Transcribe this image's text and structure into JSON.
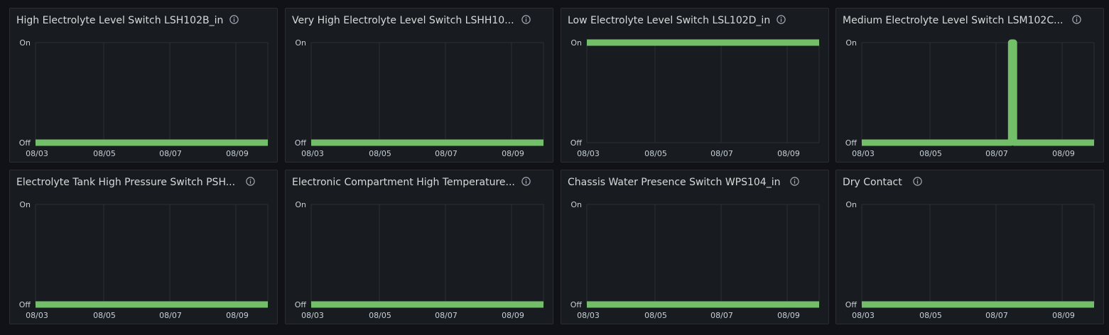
{
  "colors": {
    "series": "#73bf69",
    "panel_bg": "#181b1f",
    "page_bg": "#111217"
  },
  "panels": [
    {
      "title": "High Electrolyte Level Switch LSH102B_in",
      "chart_data": {
        "type": "line",
        "y_ticks": [
          "On",
          "Off"
        ],
        "x_ticks": [
          "08/03",
          "08/05",
          "08/07",
          "08/09"
        ],
        "points": [
          [
            0,
            0
          ],
          [
            1,
            0
          ]
        ]
      }
    },
    {
      "title": "Very High Electrolyte Level Switch LSHH10...",
      "chart_data": {
        "type": "line",
        "y_ticks": [
          "On",
          "Off"
        ],
        "x_ticks": [
          "08/03",
          "08/05",
          "08/07",
          "08/09"
        ],
        "points": [
          [
            0,
            0
          ],
          [
            1,
            0
          ]
        ]
      }
    },
    {
      "title": "Low Electrolyte Level Switch LSL102D_in",
      "chart_data": {
        "type": "line",
        "y_ticks": [
          "On",
          "Off"
        ],
        "x_ticks": [
          "08/03",
          "08/05",
          "08/07",
          "08/09"
        ],
        "points": [
          [
            0,
            1
          ],
          [
            1,
            1
          ]
        ]
      }
    },
    {
      "title": "Medium Electrolyte Level Switch LSM102C...",
      "chart_data": {
        "type": "line",
        "y_ticks": [
          "On",
          "Off"
        ],
        "x_ticks": [
          "08/03",
          "08/05",
          "08/07",
          "08/09"
        ],
        "points": [
          [
            0,
            0
          ],
          [
            0.643,
            0
          ],
          [
            0.643,
            1
          ],
          [
            0.655,
            1
          ],
          [
            0.655,
            0
          ],
          [
            1,
            0
          ]
        ]
      }
    },
    {
      "title": "Electrolyte Tank High Pressure Switch PSH...",
      "chart_data": {
        "type": "line",
        "y_ticks": [
          "On",
          "Off"
        ],
        "x_ticks": [
          "08/03",
          "08/05",
          "08/07",
          "08/09"
        ],
        "points": [
          [
            0,
            0
          ],
          [
            1,
            0
          ]
        ]
      }
    },
    {
      "title": "Electronic Compartment High Temperature...",
      "chart_data": {
        "type": "line",
        "y_ticks": [
          "On",
          "Off"
        ],
        "x_ticks": [
          "08/03",
          "08/05",
          "08/07",
          "08/09"
        ],
        "points": [
          [
            0,
            0
          ],
          [
            1,
            0
          ]
        ]
      }
    },
    {
      "title": "Chassis Water Presence Switch WPS104_in",
      "chart_data": {
        "type": "line",
        "y_ticks": [
          "On",
          "Off"
        ],
        "x_ticks": [
          "08/03",
          "08/05",
          "08/07",
          "08/09"
        ],
        "points": [
          [
            0,
            0
          ],
          [
            1,
            0
          ]
        ]
      }
    },
    {
      "title": "Dry Contact",
      "chart_data": {
        "type": "line",
        "y_ticks": [
          "On",
          "Off"
        ],
        "x_ticks": [
          "08/03",
          "08/05",
          "08/07",
          "08/09"
        ],
        "points": [
          [
            0,
            0
          ],
          [
            1,
            0
          ]
        ]
      }
    }
  ]
}
